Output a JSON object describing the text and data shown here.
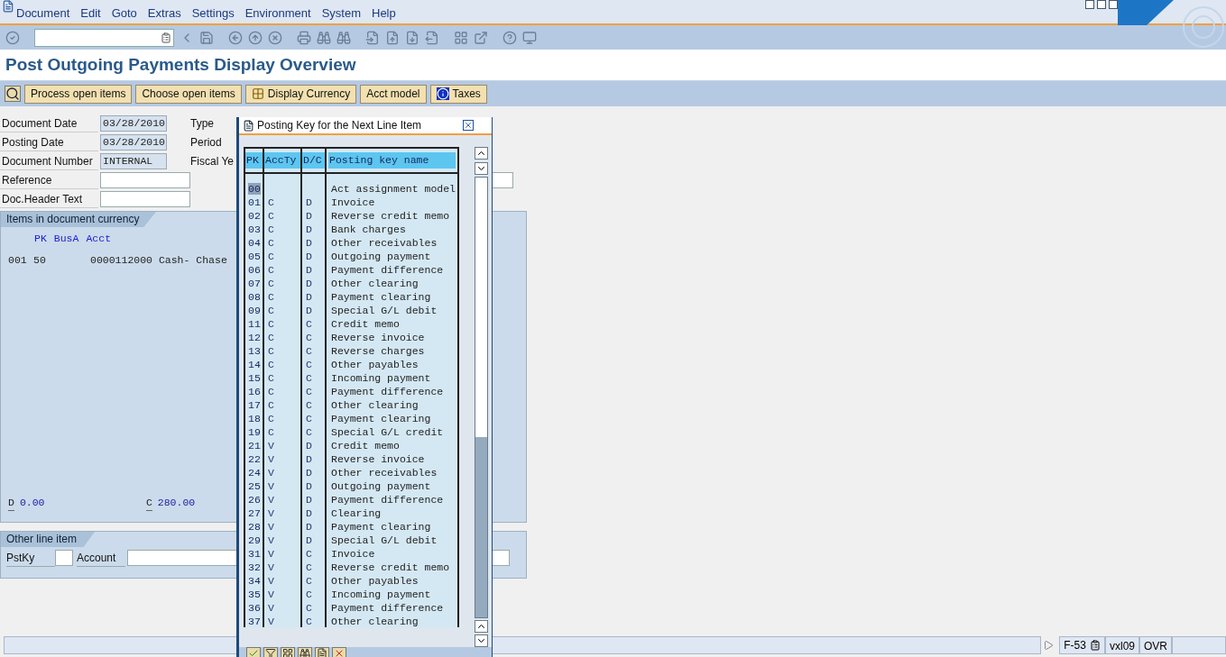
{
  "menu": [
    "Document",
    "Edit",
    "Goto",
    "Extras",
    "Settings",
    "Environment",
    "System",
    "Help"
  ],
  "title": "Post Outgoing Payments Display Overview",
  "app_toolbar": [
    {
      "label": "Process open items",
      "kind": "plain"
    },
    {
      "label": "Choose open items",
      "kind": "plain"
    },
    {
      "label": "Display Currency",
      "kind": "currency"
    },
    {
      "label": "Acct model",
      "kind": "plain"
    },
    {
      "label": "Taxes",
      "kind": "info"
    }
  ],
  "header_fields": [
    {
      "label": "Document Date",
      "value": "03/28/2010",
      "readonly": true
    },
    {
      "label": "Posting Date",
      "value": "03/28/2010",
      "readonly": true
    },
    {
      "label": "Document Number",
      "value": "INTERNAL",
      "readonly": true
    },
    {
      "label": "Reference",
      "readonly": false
    },
    {
      "label": "Doc.Header Text",
      "readonly": false
    }
  ],
  "side_labels": [
    "Type",
    "Period",
    "Fiscal Ye"
  ],
  "items_panel": {
    "tab": "Items in document currency",
    "columns": [
      "PK",
      "BusA",
      "Acct"
    ],
    "row": {
      "line": "001",
      "pk": "50",
      "account": "0000112000 Cash- Chase"
    },
    "debit_label": "D",
    "debit": "0.00",
    "credit_label": "C",
    "credit": "280.00"
  },
  "other_line_item": {
    "tab": "Other line item",
    "fields": [
      "PstKy",
      "Account"
    ]
  },
  "popup": {
    "title": "Posting Key for the Next Line Item",
    "columns": [
      "PK",
      "AccTy",
      "D/C",
      "Posting key name"
    ],
    "rows": [
      {
        "pk": "00",
        "acc": "",
        "dc": "",
        "name": "Act assignment model",
        "selected": true
      },
      {
        "pk": "01",
        "acc": "C",
        "dc": "D",
        "name": "Invoice",
        "selected": false
      },
      {
        "pk": "02",
        "acc": "C",
        "dc": "D",
        "name": "Reverse credit memo",
        "selected": false
      },
      {
        "pk": "03",
        "acc": "C",
        "dc": "D",
        "name": "Bank charges",
        "selected": false
      },
      {
        "pk": "04",
        "acc": "C",
        "dc": "D",
        "name": "Other receivables",
        "selected": false
      },
      {
        "pk": "05",
        "acc": "C",
        "dc": "D",
        "name": "Outgoing payment",
        "selected": false
      },
      {
        "pk": "06",
        "acc": "C",
        "dc": "D",
        "name": "Payment difference",
        "selected": false
      },
      {
        "pk": "07",
        "acc": "C",
        "dc": "D",
        "name": "Other clearing",
        "selected": false
      },
      {
        "pk": "08",
        "acc": "C",
        "dc": "D",
        "name": "Payment clearing",
        "selected": false
      },
      {
        "pk": "09",
        "acc": "C",
        "dc": "D",
        "name": "Special G/L debit",
        "selected": false
      },
      {
        "pk": "11",
        "acc": "C",
        "dc": "C",
        "name": "Credit memo",
        "selected": false
      },
      {
        "pk": "12",
        "acc": "C",
        "dc": "C",
        "name": "Reverse invoice",
        "selected": false
      },
      {
        "pk": "13",
        "acc": "C",
        "dc": "C",
        "name": "Reverse charges",
        "selected": false
      },
      {
        "pk": "14",
        "acc": "C",
        "dc": "C",
        "name": "Other payables",
        "selected": false
      },
      {
        "pk": "15",
        "acc": "C",
        "dc": "C",
        "name": "Incoming payment",
        "selected": false
      },
      {
        "pk": "16",
        "acc": "C",
        "dc": "C",
        "name": "Payment difference",
        "selected": false
      },
      {
        "pk": "17",
        "acc": "C",
        "dc": "C",
        "name": "Other clearing",
        "selected": false
      },
      {
        "pk": "18",
        "acc": "C",
        "dc": "C",
        "name": "Payment clearing",
        "selected": false
      },
      {
        "pk": "19",
        "acc": "C",
        "dc": "C",
        "name": "Special G/L credit",
        "selected": false
      },
      {
        "pk": "21",
        "acc": "V",
        "dc": "D",
        "name": "Credit memo",
        "selected": false
      },
      {
        "pk": "22",
        "acc": "V",
        "dc": "D",
        "name": "Reverse invoice",
        "selected": false
      },
      {
        "pk": "24",
        "acc": "V",
        "dc": "D",
        "name": "Other receivables",
        "selected": false
      },
      {
        "pk": "25",
        "acc": "V",
        "dc": "D",
        "name": "Outgoing payment",
        "selected": false
      },
      {
        "pk": "26",
        "acc": "V",
        "dc": "D",
        "name": "Payment difference",
        "selected": false
      },
      {
        "pk": "27",
        "acc": "V",
        "dc": "D",
        "name": "Clearing",
        "selected": false
      },
      {
        "pk": "28",
        "acc": "V",
        "dc": "D",
        "name": "Payment clearing",
        "selected": false
      },
      {
        "pk": "29",
        "acc": "V",
        "dc": "D",
        "name": "Special G/L debit",
        "selected": false
      },
      {
        "pk": "31",
        "acc": "V",
        "dc": "C",
        "name": "Invoice",
        "selected": false
      },
      {
        "pk": "32",
        "acc": "V",
        "dc": "C",
        "name": "Reverse credit memo",
        "selected": false
      },
      {
        "pk": "34",
        "acc": "V",
        "dc": "C",
        "name": "Other payables",
        "selected": false
      },
      {
        "pk": "35",
        "acc": "V",
        "dc": "C",
        "name": "Incoming payment",
        "selected": false
      },
      {
        "pk": "36",
        "acc": "V",
        "dc": "C",
        "name": "Payment difference",
        "selected": false
      },
      {
        "pk": "37",
        "acc": "V",
        "dc": "C",
        "name": "Other clearing",
        "selected": false
      }
    ]
  },
  "status_bar": {
    "transaction": "F-53",
    "server": "vxl09",
    "mode": "OVR"
  }
}
